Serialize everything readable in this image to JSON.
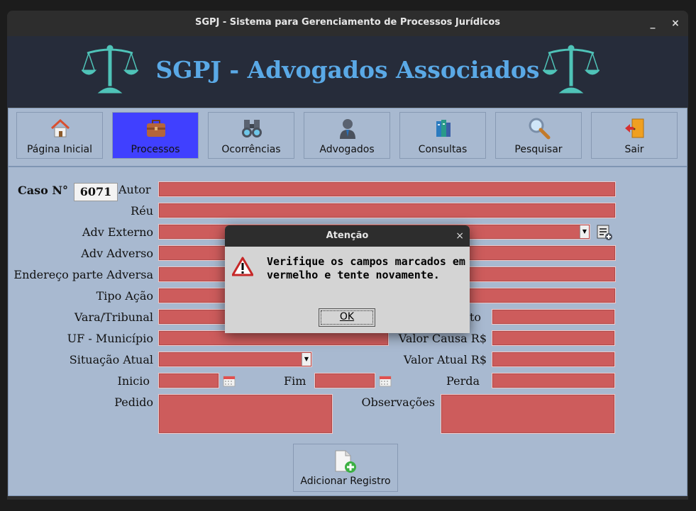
{
  "window": {
    "title": "SGPJ - Sistema para Gerenciamento de Processos Jurídicos",
    "minimize": "_",
    "close": "×"
  },
  "header": {
    "title": "SGPJ - Advogados Associados"
  },
  "nav": [
    {
      "label": "Página Inicial",
      "icon": "home-icon"
    },
    {
      "label": "Processos",
      "icon": "briefcase-icon",
      "active": true
    },
    {
      "label": "Ocorrências",
      "icon": "binoculars-icon"
    },
    {
      "label": "Advogados",
      "icon": "person-icon"
    },
    {
      "label": "Consultas",
      "icon": "books-icon"
    },
    {
      "label": "Pesquisar",
      "icon": "magnifier-icon"
    },
    {
      "label": "Sair",
      "icon": "exit-door-icon"
    }
  ],
  "form": {
    "caso_label": "Caso N°",
    "caso_value": "6071",
    "autor": "Autor",
    "reu": "Réu",
    "adv_externo": "Adv Externo",
    "adv_adverso": "Adv Adverso",
    "endereco": "Endereço parte Adversa",
    "tipo_acao": "Tipo Ação",
    "vara": "Vara/Tribunal",
    "deposito_partial": "to",
    "uf": "UF - Município",
    "valor_causa": "Valor Causa R$",
    "situacao": "Situação Atual",
    "valor_atual": "Valor Atual R$",
    "inicio": "Inicio",
    "fim": "Fim",
    "perda": "Perda",
    "pedido": "Pedido",
    "observacoes": "Observações",
    "add_button": "Adicionar Registro"
  },
  "dialog": {
    "title": "Atenção",
    "close": "×",
    "message": "Verifique os campos marcados em vermelho e tente novamente.",
    "ok": "OK"
  },
  "colors": {
    "field_error": "#cd5c5c",
    "panel": "#a8b9d0",
    "active_nav": "#4040ff",
    "title_blue": "#5aa9e6"
  }
}
